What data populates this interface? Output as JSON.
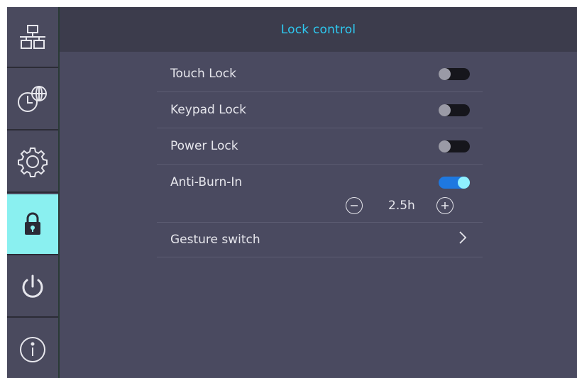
{
  "header": {
    "title": "Lock control"
  },
  "sidebar": {
    "items": [
      {
        "icon": "network-icon"
      },
      {
        "icon": "clock-globe-icon"
      },
      {
        "icon": "gear-icon"
      },
      {
        "icon": "lock-icon",
        "active": true
      },
      {
        "icon": "power-icon"
      },
      {
        "icon": "info-icon"
      }
    ]
  },
  "settings": {
    "touch_lock": {
      "label": "Touch Lock",
      "enabled": false
    },
    "keypad_lock": {
      "label": "Keypad Lock",
      "enabled": false
    },
    "power_lock": {
      "label": "Power Lock",
      "enabled": false
    },
    "anti_burn_in": {
      "label": "Anti-Burn-In",
      "enabled": true,
      "duration": "2.5h"
    },
    "gesture_switch": {
      "label": "Gesture switch"
    }
  },
  "colors": {
    "accent": "#2ec9f0",
    "active_tab": "#8af0f0",
    "toggle_on": "#1e78e0",
    "panel_bg": "#4a4a60",
    "header_bg": "#3c3c4c"
  }
}
